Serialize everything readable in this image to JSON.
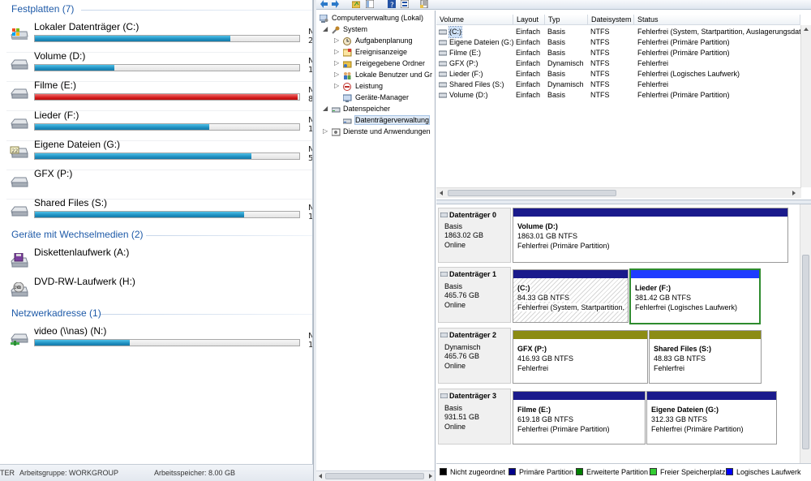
{
  "explorer": {
    "groups": [
      {
        "title": "Festplatten (7)"
      },
      {
        "title": "Geräte mit Wechselmedien (2)"
      },
      {
        "title": "Netzwerkadresse (1)"
      }
    ],
    "drives": [
      {
        "name": "Lokaler Datenträger (C:)",
        "icon": "windows-drive-icon",
        "used_fraction": 0.74,
        "trunc": "N",
        "trunc2": "2"
      },
      {
        "name": "Volume (D:)",
        "icon": "hard-drive-icon",
        "used_fraction": 0.3,
        "trunc": "N",
        "trunc2": "1"
      },
      {
        "name": "Filme (E:)",
        "icon": "hard-drive-icon",
        "used_fraction": 0.995,
        "full": true,
        "trunc": "N",
        "trunc2": "8"
      },
      {
        "name": "Lieder (F:)",
        "icon": "hard-drive-icon",
        "used_fraction": 0.66,
        "trunc": "N",
        "trunc2": "1"
      },
      {
        "name": "Eigene Dateien (G:)",
        "icon": "drive-with-folder-icon",
        "used_fraction": 0.82,
        "trunc": "N",
        "trunc2": "5"
      },
      {
        "name": "GFX (P:)",
        "icon": "hard-drive-icon",
        "used_fraction": 0,
        "trunc": "",
        "trunc2": ""
      },
      {
        "name": "Shared Files (S:)",
        "icon": "hard-drive-icon",
        "used_fraction": 0.79,
        "trunc": "N",
        "trunc2": "1"
      }
    ],
    "removable": [
      {
        "name": "Diskettenlaufwerk (A:)",
        "icon": "floppy-drive-icon"
      },
      {
        "name": "DVD-RW-Laufwerk (H:)",
        "icon": "dvd-drive-icon"
      }
    ],
    "network": [
      {
        "name": "video (\\\\nas) (N:)",
        "icon": "network-drive-icon",
        "used_fraction": 0.36,
        "trunc": "N",
        "trunc2": "1"
      }
    ],
    "status": {
      "computer": "TER",
      "workgroup": "Arbeitsgruppe: WORKGROUP",
      "memory": "Arbeitsspeicher: 8.00 GB"
    }
  },
  "tree": {
    "root": "Computerverwaltung (Lokal)",
    "system": "System",
    "aufgaben": "Aufgabenplanung",
    "ereignis": "Ereignisanzeige",
    "freigaben": "Freigegebene Ordner",
    "benutzer": "Lokale Benutzer und Gr",
    "leistung": "Leistung",
    "geraete": "Geräte-Manager",
    "speicher": "Datenspeicher",
    "dtverw": "Datenträgerverwaltung",
    "dienste": "Dienste und Anwendungen"
  },
  "volumes": {
    "headers": [
      "Volume",
      "Layout",
      "Typ",
      "Dateisystem",
      "Status"
    ],
    "rows": [
      [
        "(C:)",
        "Einfach",
        "Basis",
        "NTFS",
        "Fehlerfrei (System, Startpartition, Auslagerungsdat"
      ],
      [
        "Eigene Dateien (G:)",
        "Einfach",
        "Basis",
        "NTFS",
        "Fehlerfrei (Primäre Partition)"
      ],
      [
        "Filme (E:)",
        "Einfach",
        "Basis",
        "NTFS",
        "Fehlerfrei (Primäre Partition)"
      ],
      [
        "GFX (P:)",
        "Einfach",
        "Dynamisch",
        "NTFS",
        "Fehlerfrei"
      ],
      [
        "Lieder (F:)",
        "Einfach",
        "Basis",
        "NTFS",
        "Fehlerfrei (Logisches Laufwerk)"
      ],
      [
        "Shared Files (S:)",
        "Einfach",
        "Dynamisch",
        "NTFS",
        "Fehlerfrei"
      ],
      [
        "Volume (D:)",
        "Einfach",
        "Basis",
        "NTFS",
        "Fehlerfrei (Primäre Partition)"
      ]
    ]
  },
  "disks": [
    {
      "title": "Datenträger 0",
      "type": "Basis",
      "size": "1863.02 GB",
      "state": "Online",
      "parts": [
        {
          "name": "Volume  (D:)",
          "size": "1863.01 GB NTFS",
          "status": "Fehlerfrei (Primäre Partition)"
        }
      ]
    },
    {
      "title": "Datenträger 1",
      "type": "Basis",
      "size": "465.76 GB",
      "state": "Online",
      "parts": [
        {
          "name": "(C:)",
          "size": "84.33 GB NTFS",
          "status": "Fehlerfrei (System, Startpartition,"
        },
        {
          "name": "Lieder  (F:)",
          "size": "381.42 GB NTFS",
          "status": "Fehlerfrei (Logisches Laufwerk)"
        }
      ]
    },
    {
      "title": "Datenträger 2",
      "type": "Dynamisch",
      "size": "465.76 GB",
      "state": "Online",
      "parts": [
        {
          "name": "GFX  (P:)",
          "size": "416.93 GB NTFS",
          "status": "Fehlerfrei"
        },
        {
          "name": "Shared Files  (S:)",
          "size": "48.83 GB NTFS",
          "status": "Fehlerfrei"
        }
      ]
    },
    {
      "title": "Datenträger 3",
      "type": "Basis",
      "size": "931.51 GB",
      "state": "Online",
      "parts": [
        {
          "name": "Filme  (E:)",
          "size": "619.18 GB NTFS",
          "status": "Fehlerfrei (Primäre Partition)"
        },
        {
          "name": "Eigene Dateien  (G:)",
          "size": "312.33 GB NTFS",
          "status": "Fehlerfrei (Primäre Partition)"
        }
      ]
    }
  ],
  "legend": [
    {
      "label": "Nicht zugeordnet",
      "color": "#000000"
    },
    {
      "label": "Primäre Partition",
      "color": "#00008b"
    },
    {
      "label": "Erweiterte Partition",
      "color": "#008000"
    },
    {
      "label": "Freier Speicherplatz",
      "color": "#33cc33"
    },
    {
      "label": "Logisches Laufwerk",
      "color": "#0000ff"
    }
  ],
  "colors": {
    "primary": "#1a1a8c",
    "logical": "#1e3cff",
    "dynamic": "#8c8c14",
    "selected": "#2e8b2e",
    "full_bar": "#d61e1e",
    "bar": "#1f8fc0"
  }
}
